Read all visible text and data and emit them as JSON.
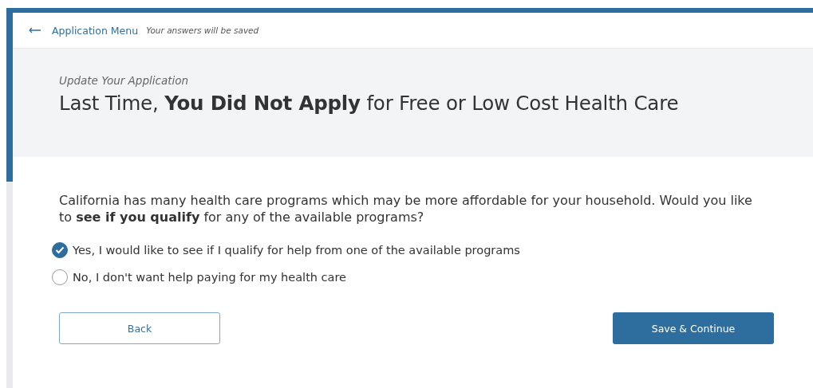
{
  "nav": {
    "back_link": "Application Menu",
    "note": "Your answers will be saved"
  },
  "header": {
    "subtitle": "Update Your Application",
    "title": "Last Time, **You Did Not Apply** for Free or Low Cost Health Care"
  },
  "question": "California has many health care programs which may be more affordable for your household. Would you like to **see if you qualify** for any of the available programs?",
  "options": [
    {
      "label": "Yes, I would like to see if I qualify for help from one of the available programs",
      "selected": true
    },
    {
      "label": "No, I don't want help paying for my health care",
      "selected": false
    }
  ],
  "buttons": {
    "back": "Back",
    "primary": "Save & Continue"
  }
}
